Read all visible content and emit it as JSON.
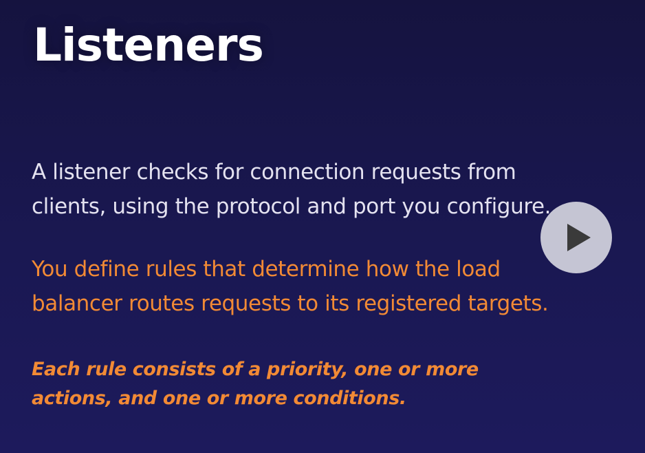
{
  "slide": {
    "title": "Listeners",
    "paragraph1": {
      "lines": [
        "A listener checks for connection requests from",
        "clients, using the protocol and port you configure."
      ]
    },
    "paragraph2": {
      "lines": [
        "You define rules that determine how the load",
        "balancer routes requests to its registered targets."
      ]
    },
    "paragraph3": {
      "lines": [
        "Each rule consists of a priority, one or more",
        "actions, and one or more conditions."
      ]
    }
  },
  "colors": {
    "background": "#1a1852",
    "title": "#ffffff",
    "body_text": "#e4e2f0",
    "accent": "#f28a35",
    "play_button_fill": "#ebebf0",
    "play_icon": "#3a3a3a"
  },
  "icons": {
    "play": "play-icon"
  }
}
